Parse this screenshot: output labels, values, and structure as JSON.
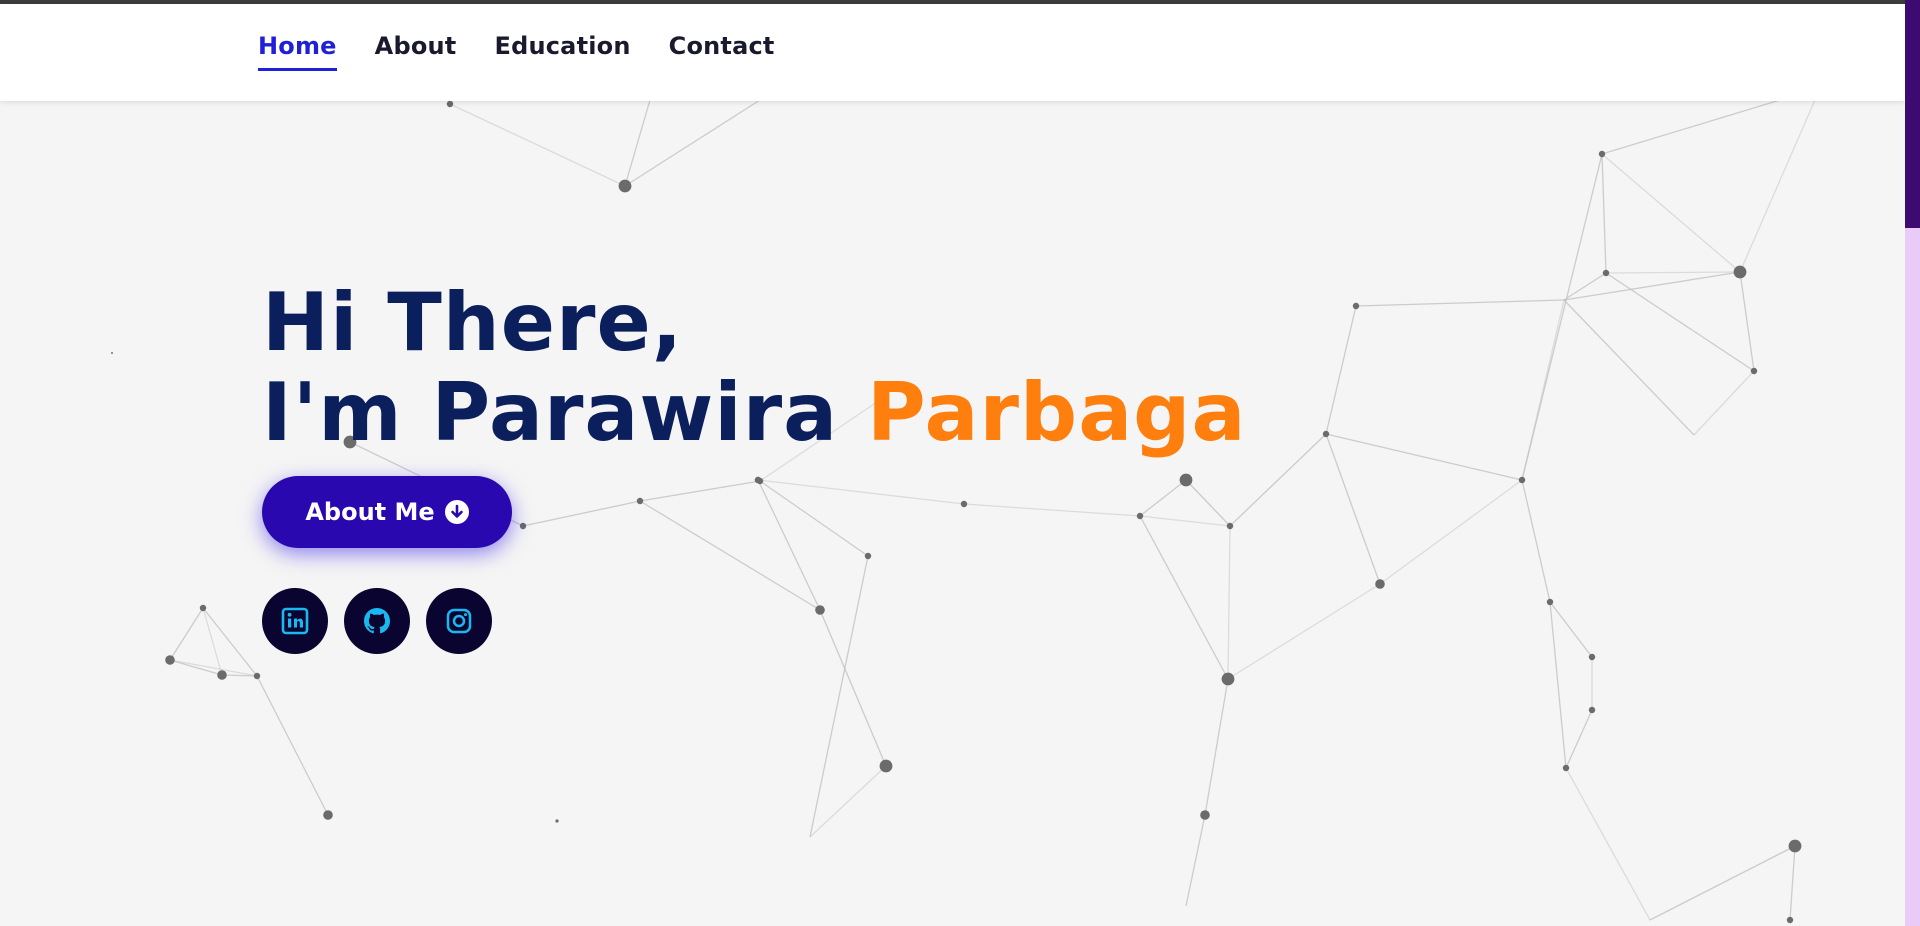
{
  "nav": {
    "items": [
      {
        "label": "Home",
        "active": true
      },
      {
        "label": "About",
        "active": false
      },
      {
        "label": "Education",
        "active": false
      },
      {
        "label": "Contact",
        "active": false
      }
    ]
  },
  "hero": {
    "greeting": "Hi There,",
    "intro": "I'm Parawira",
    "highlight": "Parbaga",
    "button_label": "About Me"
  },
  "socials": [
    {
      "icon": "linkedin-icon"
    },
    {
      "icon": "github-icon"
    },
    {
      "icon": "instagram-icon"
    }
  ],
  "colors": {
    "accent": "#2020d6",
    "highlight": "#ff7f0e",
    "heading": "#0b1f5c",
    "button": "#2a08b0",
    "social_bg": "#0a0530",
    "social_icon": "#19b8f0",
    "scroll_thumb": "#3d0a72",
    "scroll_track": "#eacbf7"
  }
}
